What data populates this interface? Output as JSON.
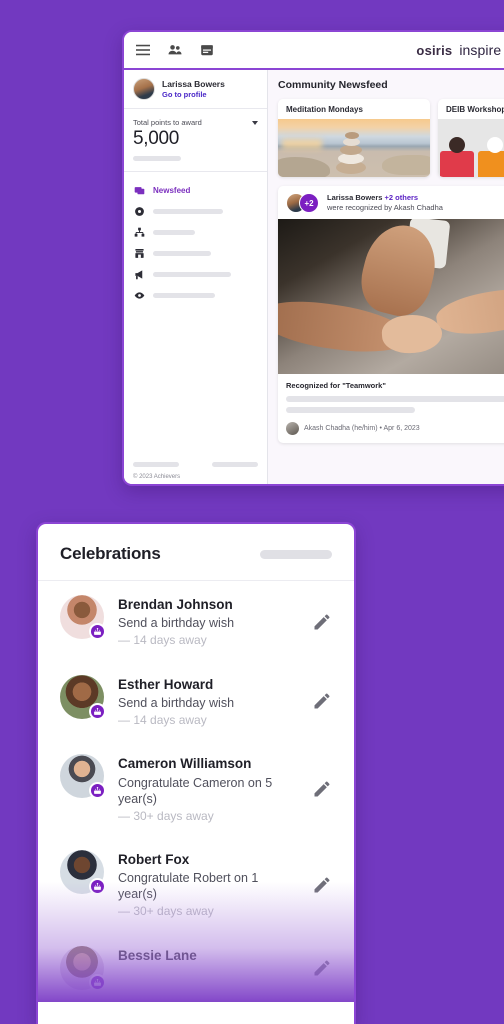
{
  "theme": {
    "background_purple": "#7239c0",
    "accent_purple": "#7b1fc1",
    "link_purple": "#4a28c8",
    "border_purple": "#8b45d4"
  },
  "app_window": {
    "header": {
      "icons": [
        "hamburger-menu-icon",
        "people-icon",
        "calendar-icon"
      ],
      "brand_primary": "osiris",
      "brand_secondary": "inspire",
      "brand_mark": "✻"
    },
    "sidebar": {
      "profile": {
        "name": "Larissa Bowers",
        "link": "Go to profile",
        "avatar": "user-avatar"
      },
      "points": {
        "label": "Total points to award",
        "value": "5,000",
        "dropdown_icon": "chevron-down-icon"
      },
      "nav_items": [
        {
          "label": "Newsfeed",
          "icon": "newsfeed-icon",
          "active": true
        },
        {
          "label": "",
          "icon": "gear-icon",
          "active": false,
          "skeleton_width": 70
        },
        {
          "label": "",
          "icon": "hierarchy-icon",
          "active": false,
          "skeleton_width": 42
        },
        {
          "label": "",
          "icon": "store-icon",
          "active": false,
          "skeleton_width": 58
        },
        {
          "label": "",
          "icon": "megaphone-icon",
          "active": false,
          "skeleton_width": 78
        },
        {
          "label": "",
          "icon": "eye-icon",
          "active": false,
          "skeleton_width": 62
        }
      ],
      "footer": {
        "copyright": "© 2023 Achievers"
      }
    },
    "newsfeed": {
      "title": "Community Newsfeed",
      "promo_cards": [
        {
          "title": "Meditation Mondays",
          "image": "zen-stones-sunset-photo"
        },
        {
          "title": "DEIB Workshop",
          "image": "diverse-people-illustration"
        }
      ],
      "recognition_post": {
        "recipient": "Larissa Bowers",
        "others": "+2 others",
        "subtitle": "were recognized by Akash Chadha",
        "avatar_overflow": "+2",
        "image": "stacked-hands-teamwork-photo",
        "recognized_for": "Recognized for \"Teamwork\"",
        "author": "Akash Chadha (he/him) • Apr 6, 2023"
      }
    }
  },
  "celebrations": {
    "title": "Celebrations",
    "items": [
      {
        "name": "Brendan Johnson",
        "action": "Send a birthday wish",
        "when": "— 14 days away",
        "badge": "birthday-cake-icon",
        "edit_icon": "pencil-icon",
        "avatar_class": "av-brendan"
      },
      {
        "name": "Esther Howard",
        "action": "Send a birthday wish",
        "when": "— 14 days away",
        "badge": "birthday-cake-icon",
        "edit_icon": "pencil-icon",
        "avatar_class": "av-esther"
      },
      {
        "name": "Cameron Williamson",
        "action": "Congratulate Cameron on 5 year(s)",
        "when": "— 30+ days away",
        "badge": "birthday-cake-icon",
        "edit_icon": "pencil-icon",
        "avatar_class": "av-cameron"
      },
      {
        "name": "Robert Fox",
        "action": "Congratulate Robert on 1 year(s)",
        "when": "— 30+ days away",
        "badge": "birthday-cake-icon",
        "edit_icon": "pencil-icon",
        "avatar_class": "av-robert"
      },
      {
        "name": "Bessie Lane",
        "action": "",
        "when": "",
        "badge": "birthday-cake-icon",
        "edit_icon": "pencil-icon",
        "avatar_class": "av-bessie"
      }
    ]
  }
}
